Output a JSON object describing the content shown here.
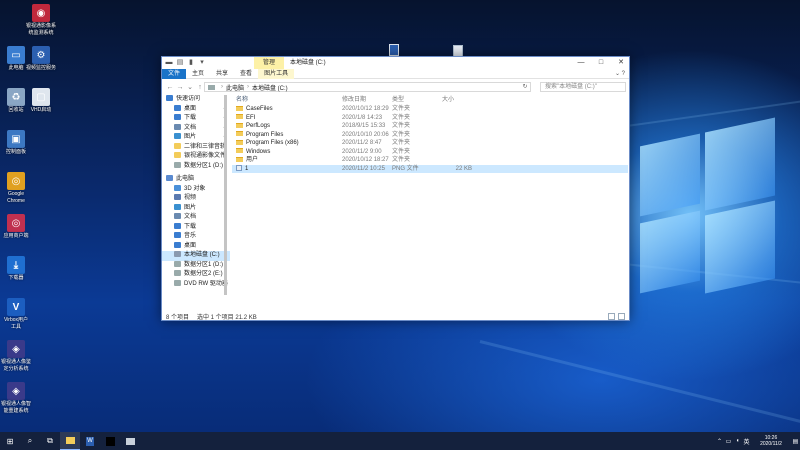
{
  "desktop": {
    "icons": [
      {
        "name": "corp-app-icon",
        "label": "银视通影像系\n统监测系统",
        "color": "#c0283c",
        "glyph": "◉"
      },
      {
        "name": "this-pc-icon",
        "label": "此电脑",
        "color": "#3a7dd0",
        "glyph": "▭"
      },
      {
        "name": "monitor-app-icon",
        "label": "视频监控服务",
        "color": "#2b5fb0",
        "glyph": "⚙"
      },
      {
        "name": "recycle-bin-icon",
        "label": "回收站",
        "color": "#8aa6c4",
        "glyph": "♻"
      },
      {
        "name": "vhd-icon",
        "label": "VHD启动",
        "color": "#dfe6ee",
        "glyph": "▢"
      },
      {
        "name": "control-panel-icon",
        "label": "控制面板",
        "color": "#3c78c3",
        "glyph": "▣"
      },
      {
        "name": "chrome-icon",
        "label": "Google\nChrome",
        "color": "#e0a020",
        "glyph": "◎"
      },
      {
        "name": "app-market-icon",
        "label": "应用商户端",
        "color": "#c03050",
        "glyph": "◎"
      },
      {
        "name": "download-icon",
        "label": "下载器",
        "color": "#1f6fd1",
        "glyph": "⤓"
      },
      {
        "name": "virbox-icon",
        "label": "Virbox用户\n工具",
        "color": "#1c5ec0",
        "glyph": "V"
      },
      {
        "name": "analysis-app-icon",
        "label": "银视通人像鉴\n定分析系统",
        "color": "#3a3a8a",
        "glyph": "◈"
      },
      {
        "name": "build-app-icon",
        "label": "银视通人像智\n能重建系统",
        "color": "#3a3a8a",
        "glyph": "◈"
      }
    ]
  },
  "explorer": {
    "context_tab": "管理",
    "title": "本地磁盘 (C:)",
    "ribbon_tabs": [
      "文件",
      "主页",
      "共享",
      "查看",
      "图片工具"
    ],
    "address": {
      "root": "此电脑",
      "current": "本地磁盘 (C:)"
    },
    "search_placeholder": "搜索\"本地磁盘 (C:)\"",
    "nav": {
      "quick_access": "快速访问",
      "pinned": [
        {
          "label": "桌面",
          "color": "#3a7dd0"
        },
        {
          "label": "下载",
          "color": "#3a7dd0"
        },
        {
          "label": "文档",
          "color": "#6a8ab0"
        },
        {
          "label": "图片",
          "color": "#3a90d0"
        }
      ],
      "recent": [
        {
          "label": "二律和三律音轨",
          "color": "#f3cc5a"
        },
        {
          "label": "银视通影像文件",
          "color": "#f3cc5a"
        },
        {
          "label": "数据分区1 (D:)",
          "color": "#9aa"
        }
      ],
      "this_pc": "此电脑",
      "pc_items": [
        {
          "label": "3D 对象",
          "color": "#4a90d9"
        },
        {
          "label": "视频",
          "color": "#5a7ab0"
        },
        {
          "label": "图片",
          "color": "#3a90d0"
        },
        {
          "label": "文档",
          "color": "#6a8ab0"
        },
        {
          "label": "下载",
          "color": "#3a7dd0"
        },
        {
          "label": "音乐",
          "color": "#3a7dd0"
        },
        {
          "label": "桌面",
          "color": "#3a7dd0"
        },
        {
          "label": "本地磁盘 (C:)",
          "color": "#8a9ab0",
          "selected": true
        },
        {
          "label": "数据分区1 (D:)",
          "color": "#9aa"
        },
        {
          "label": "数据分区2 (E:)",
          "color": "#9aa"
        },
        {
          "label": "DVD RW 驱动器",
          "color": "#9aa"
        }
      ]
    },
    "columns": {
      "name": "名称",
      "date": "修改日期",
      "type": "类型",
      "size": "大小"
    },
    "files": [
      {
        "name": "CaseFiles",
        "date": "2020/10/12 18:29",
        "type": "文件夹",
        "size": "",
        "kind": "folder"
      },
      {
        "name": "EFI",
        "date": "2020/1/8 14:23",
        "type": "文件夹",
        "size": "",
        "kind": "folder"
      },
      {
        "name": "PerfLogs",
        "date": "2018/9/15 15:33",
        "type": "文件夹",
        "size": "",
        "kind": "folder"
      },
      {
        "name": "Program Files",
        "date": "2020/10/10 20:06",
        "type": "文件夹",
        "size": "",
        "kind": "folder"
      },
      {
        "name": "Program Files (x86)",
        "date": "2020/11/2 8:47",
        "type": "文件夹",
        "size": "",
        "kind": "folder"
      },
      {
        "name": "Windows",
        "date": "2020/11/2 9:00",
        "type": "文件夹",
        "size": "",
        "kind": "folder"
      },
      {
        "name": "用户",
        "date": "2020/10/12 18:27",
        "type": "文件夹",
        "size": "",
        "kind": "folder"
      },
      {
        "name": "1",
        "date": "2020/11/2 10:25",
        "type": "PNG 文件",
        "size": "22 KB",
        "kind": "png",
        "selected": true
      }
    ],
    "status": {
      "count": "8 个项目",
      "selection": "选中 1 个项目  21.2 KB"
    }
  },
  "taskbar": {
    "clock_time": "10:26",
    "clock_date": "2020/11/2"
  }
}
